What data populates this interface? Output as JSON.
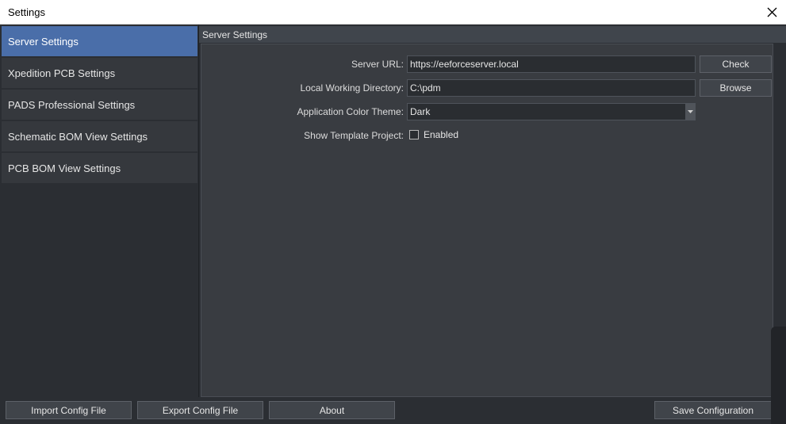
{
  "window": {
    "title": "Settings",
    "close_icon": "close-icon"
  },
  "sidebar": {
    "items": [
      {
        "label": "Server Settings",
        "active": true
      },
      {
        "label": "Xpedition PCB Settings",
        "active": false
      },
      {
        "label": "PADS Professional Settings",
        "active": false
      },
      {
        "label": "Schematic BOM View Settings",
        "active": false
      },
      {
        "label": "PCB BOM View Settings",
        "active": false
      }
    ]
  },
  "panel": {
    "header": "Server Settings",
    "server_url": {
      "label": "Server URL:",
      "value": "https://eeforceserver.local",
      "button": "Check"
    },
    "working_dir": {
      "label": "Local Working Directory:",
      "value": "C:\\pdm",
      "button": "Browse"
    },
    "color_theme": {
      "label": "Application Color Theme:",
      "value": "Dark"
    },
    "template_project": {
      "label": "Show Template Project:",
      "checkbox_label": "Enabled",
      "checked": false
    }
  },
  "footer": {
    "import": "Import Config File",
    "export": "Export Config File",
    "about": "About",
    "save": "Save Configuration"
  },
  "colors": {
    "accent": "#4a6ea9",
    "background": "#2b2e33",
    "panel": "#393c41",
    "titlebar": "#ffffff"
  }
}
